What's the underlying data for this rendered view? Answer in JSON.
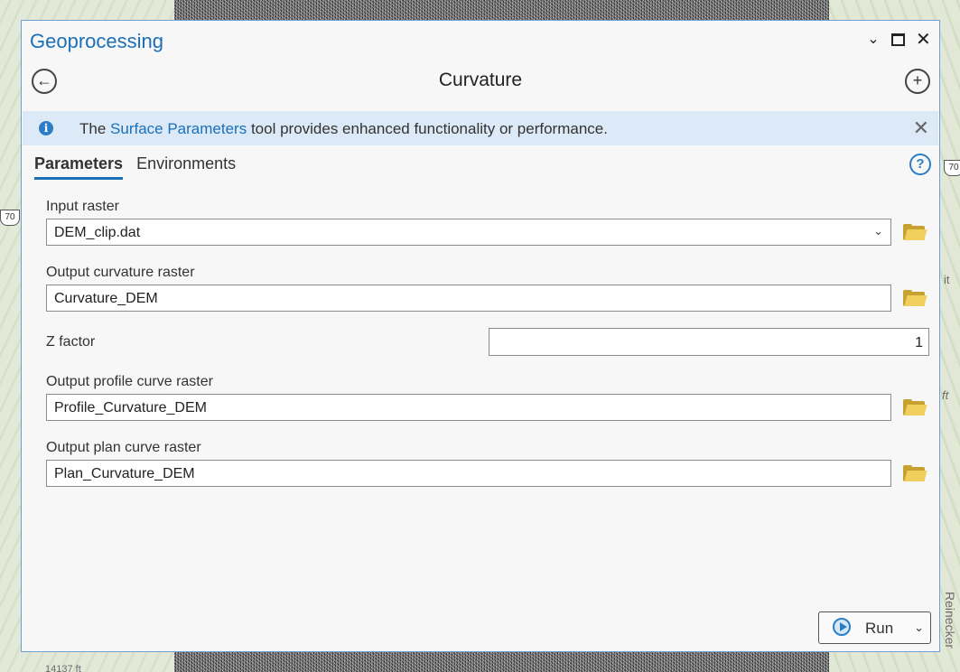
{
  "map": {
    "highway_left": "70",
    "highway_right": "70",
    "side_text_right": "it",
    "side_text_ft": "ft",
    "street_label": "Reinecker",
    "elevation_label": "14137 ft"
  },
  "window": {
    "title": "Geoprocessing",
    "controls": [
      "chevron-down",
      "maximize",
      "close"
    ]
  },
  "tool": {
    "title": "Curvature",
    "back_icon": "back-arrow-icon",
    "add_icon": "add-icon"
  },
  "banner": {
    "prefix": "The ",
    "link": "Surface Parameters",
    "suffix": " tool provides enhanced functionality or performance."
  },
  "tabs": {
    "parameters": "Parameters",
    "environments": "Environments"
  },
  "params": {
    "input_raster": {
      "label": "Input raster",
      "value": "DEM_clip.dat"
    },
    "output_curvature": {
      "label": "Output curvature raster",
      "value": "Curvature_DEM"
    },
    "z_factor": {
      "label": "Z factor",
      "value": "1"
    },
    "output_profile": {
      "label": "Output profile curve raster",
      "value": "Profile_Curvature_DEM"
    },
    "output_plan": {
      "label": "Output plan curve raster",
      "value": "Plan_Curvature_DEM"
    }
  },
  "run": {
    "label": "Run"
  },
  "colors": {
    "accent": "#1b6fb8",
    "banner_bg": "#dbeaf6",
    "folder": "#f1cf5d"
  }
}
